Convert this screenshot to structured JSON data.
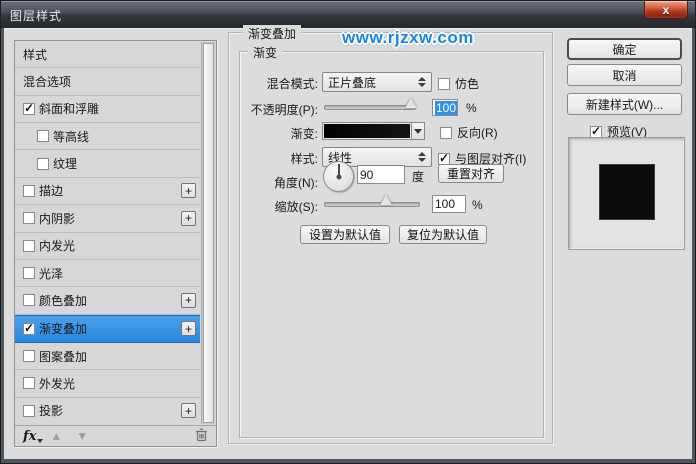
{
  "window": {
    "title": "图层样式",
    "close_label": "x",
    "watermark": "www.rjzxw.com"
  },
  "sidebar": {
    "items": [
      {
        "label": "样式",
        "checkbox": false,
        "checked": false,
        "indent": false,
        "plus": false,
        "selected": false
      },
      {
        "label": "混合选项",
        "checkbox": false,
        "checked": false,
        "indent": false,
        "plus": false,
        "selected": false
      },
      {
        "label": "斜面和浮雕",
        "checkbox": true,
        "checked": true,
        "indent": false,
        "plus": false,
        "selected": false
      },
      {
        "label": "等高线",
        "checkbox": true,
        "checked": false,
        "indent": true,
        "plus": false,
        "selected": false
      },
      {
        "label": "纹理",
        "checkbox": true,
        "checked": false,
        "indent": true,
        "plus": false,
        "selected": false
      },
      {
        "label": "描边",
        "checkbox": true,
        "checked": false,
        "indent": false,
        "plus": true,
        "selected": false
      },
      {
        "label": "内阴影",
        "checkbox": true,
        "checked": false,
        "indent": false,
        "plus": true,
        "selected": false
      },
      {
        "label": "内发光",
        "checkbox": true,
        "checked": false,
        "indent": false,
        "plus": false,
        "selected": false
      },
      {
        "label": "光泽",
        "checkbox": true,
        "checked": false,
        "indent": false,
        "plus": false,
        "selected": false
      },
      {
        "label": "颜色叠加",
        "checkbox": true,
        "checked": false,
        "indent": false,
        "plus": true,
        "selected": false
      },
      {
        "label": "渐变叠加",
        "checkbox": true,
        "checked": true,
        "indent": false,
        "plus": true,
        "selected": true
      },
      {
        "label": "图案叠加",
        "checkbox": true,
        "checked": false,
        "indent": false,
        "plus": false,
        "selected": false
      },
      {
        "label": "外发光",
        "checkbox": true,
        "checked": false,
        "indent": false,
        "plus": false,
        "selected": false
      },
      {
        "label": "投影",
        "checkbox": true,
        "checked": false,
        "indent": false,
        "plus": true,
        "selected": false
      }
    ],
    "footer": {
      "fx_label": "fx",
      "move_up_icon": "▲",
      "move_down_icon": "▼",
      "trash_icon": "trash"
    }
  },
  "panel": {
    "title": "渐变叠加",
    "group_title": "渐变",
    "blend_mode": {
      "label": "混合模式:",
      "value": "正片叠底",
      "dither_label": "仿色",
      "dither_checked": false
    },
    "opacity": {
      "label": "不透明度(P):",
      "value": "100",
      "unit": "%"
    },
    "gradient": {
      "label": "渐变:",
      "reverse_label": "反向(R)",
      "reverse_checked": false
    },
    "style": {
      "label": "样式:",
      "value": "线性",
      "align_label": "与图层对齐(I)",
      "align_checked": true
    },
    "angle": {
      "label": "角度(N):",
      "value": "90",
      "unit": "度",
      "reset_button": "重置对齐"
    },
    "scale": {
      "label": "缩放(S):",
      "value": "100",
      "unit": "%"
    },
    "set_default_button": "设置为默认值",
    "reset_default_button": "复位为默认值"
  },
  "actions": {
    "ok": "确定",
    "cancel": "取消",
    "new_style": "新建样式(W)...",
    "preview_label": "预览(V)",
    "preview_checked": true
  },
  "colors": {
    "accent_blue": "#2e90e8",
    "dialog_bg": "#dcdcdc",
    "titlebar_dark": "#33373c",
    "close_red": "#b5371d",
    "watermark_blue": "#1686e8",
    "gradient_swatch": "#0d0d0d"
  }
}
